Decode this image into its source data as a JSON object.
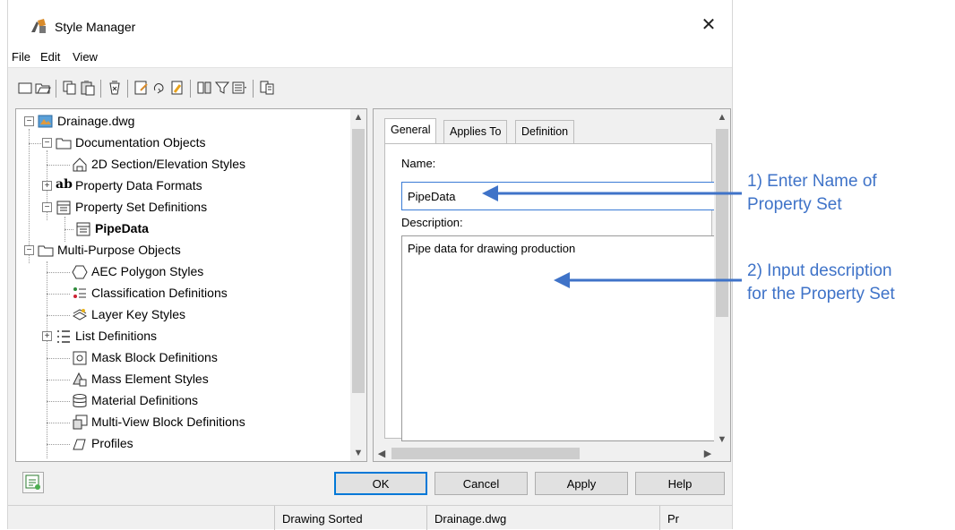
{
  "window": {
    "title": "Style Manager",
    "close_label": "✕"
  },
  "menu": [
    "File",
    "Edit",
    "View"
  ],
  "toolbar": {
    "icons": [
      "new-icon",
      "open-icon",
      "copy-icon",
      "paste-icon",
      "purge-icon",
      "edit-style-icon",
      "sort-icon",
      "clean-icon",
      "toggle-view-icon",
      "filter-icon",
      "list-view-icon",
      "inventory-icon"
    ]
  },
  "tree": {
    "items": [
      {
        "label": "Drainage.dwg",
        "icon": "drawing-file-icon",
        "expander": "−"
      },
      {
        "label": "Documentation Objects",
        "icon": "folder-icon",
        "expander": "−"
      },
      {
        "label": "2D Section/Elevation Styles",
        "icon": "section-style-icon",
        "expander": ""
      },
      {
        "label": "Property Data Formats",
        "icon": "data-format-icon",
        "expander": "+"
      },
      {
        "label": "Property Set Definitions",
        "icon": "property-set-icon",
        "expander": "−"
      },
      {
        "label": "PipeData",
        "icon": "property-set-icon",
        "expander": ""
      },
      {
        "label": "Multi-Purpose Objects",
        "icon": "folder-icon",
        "expander": "−"
      },
      {
        "label": "AEC Polygon Styles",
        "icon": "polygon-icon",
        "expander": ""
      },
      {
        "label": "Classification Definitions",
        "icon": "classification-icon",
        "expander": ""
      },
      {
        "label": "Layer Key Styles",
        "icon": "layer-key-icon",
        "expander": ""
      },
      {
        "label": "List Definitions",
        "icon": "list-icon",
        "expander": "+"
      },
      {
        "label": "Mask Block Definitions",
        "icon": "mask-block-icon",
        "expander": ""
      },
      {
        "label": "Mass Element Styles",
        "icon": "mass-element-icon",
        "expander": ""
      },
      {
        "label": "Material Definitions",
        "icon": "material-icon",
        "expander": ""
      },
      {
        "label": "Multi-View Block Definitions",
        "icon": "multiview-block-icon",
        "expander": ""
      },
      {
        "label": "Profiles",
        "icon": "profile-icon",
        "expander": ""
      }
    ],
    "selected": "PipeData"
  },
  "tabs": [
    {
      "label": "General",
      "active": true
    },
    {
      "label": "Applies To",
      "active": false
    },
    {
      "label": "Definition",
      "active": false
    }
  ],
  "general": {
    "name_label": "Name:",
    "name_value": "PipeData",
    "description_label": "Description:",
    "description_value": "Pipe data for drawing production"
  },
  "buttons": {
    "ok": "OK",
    "cancel": "Cancel",
    "apply": "Apply",
    "help": "Help"
  },
  "status": [
    "",
    "Drawing Sorted",
    "Drainage.dwg",
    "Pr"
  ],
  "annotations": {
    "one_line1": "1) Enter Name of",
    "one_line2": "Property Set",
    "two_line1": "2) Input description",
    "two_line2": "for the Property Set",
    "color": "#3f73c8"
  }
}
